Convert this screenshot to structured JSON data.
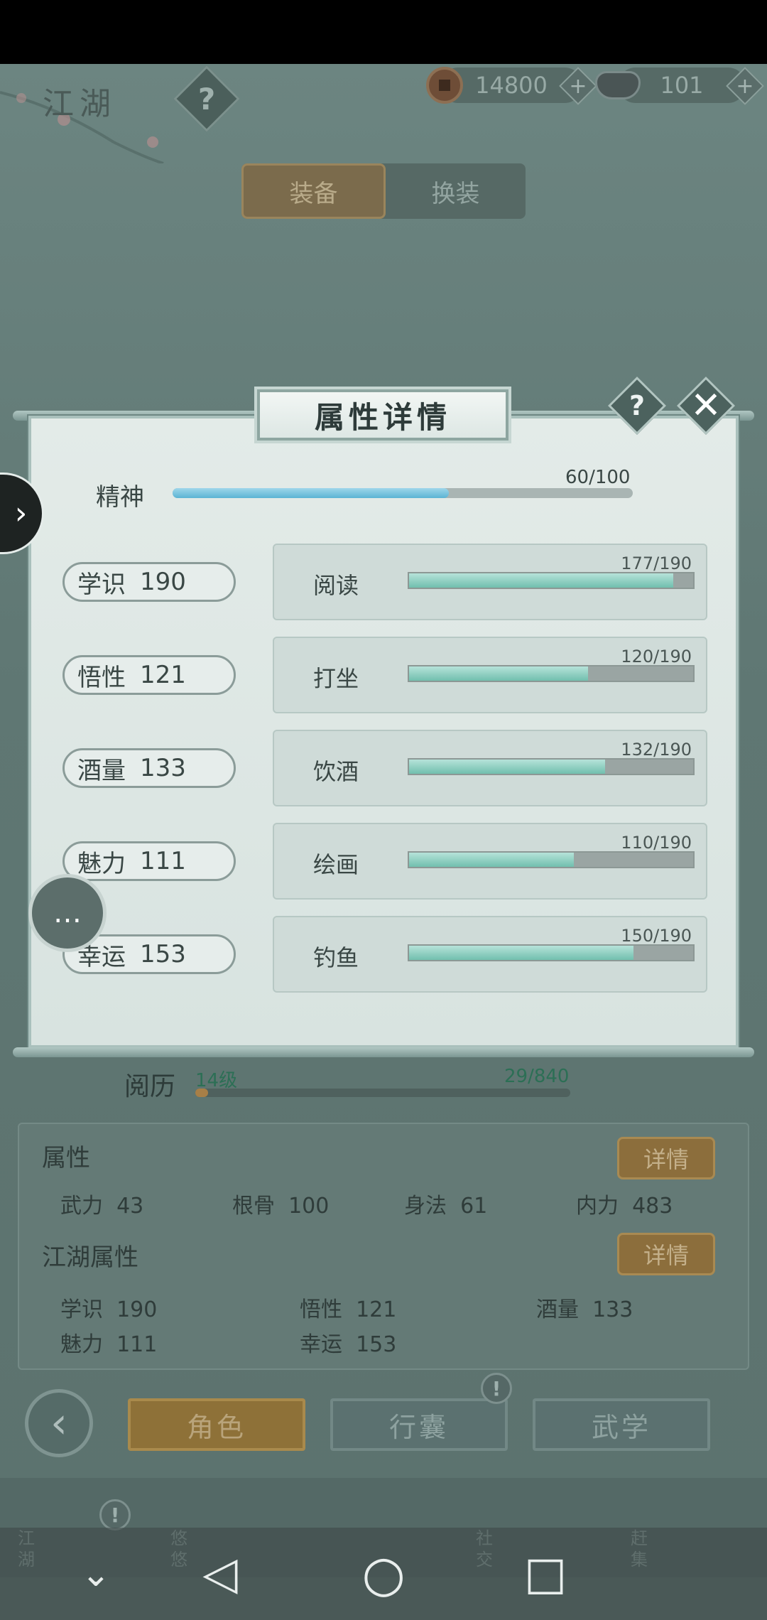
{
  "topbar": {
    "region_title": "江湖",
    "help_icon": "?",
    "copper": "14800",
    "silver": "101",
    "plus": "+"
  },
  "equip_tabs": [
    "装备",
    "换装"
  ],
  "dialog": {
    "title": "属性详情",
    "help": "?",
    "close": "✕",
    "spirit": {
      "label": "精神",
      "value": "60/100",
      "fraction": 0.6
    },
    "attributes": [
      {
        "label": "学识",
        "value": "190",
        "skill": "阅读",
        "progress": "177/190",
        "fraction": 0.93
      },
      {
        "label": "悟性",
        "value": "121",
        "skill": "打坐",
        "progress": "120/190",
        "fraction": 0.63
      },
      {
        "label": "酒量",
        "value": "133",
        "skill": "饮酒",
        "progress": "132/190",
        "fraction": 0.69
      },
      {
        "label": "魅力",
        "value": "111",
        "skill": "绘画",
        "progress": "110/190",
        "fraction": 0.58
      },
      {
        "label": "幸运",
        "value": "153",
        "skill": "钓鱼",
        "progress": "150/190",
        "fraction": 0.79
      }
    ]
  },
  "experience": {
    "label": "阅历",
    "level": "14级",
    "count": "29/840",
    "fraction": 0.035
  },
  "attributes_panel": {
    "heading": "属性",
    "detail_label": "详情",
    "stats": [
      {
        "name": "武力",
        "value": "43"
      },
      {
        "name": "根骨",
        "value": "100"
      },
      {
        "name": "身法",
        "value": "61"
      },
      {
        "name": "内力",
        "value": "483"
      }
    ],
    "jianghu_heading": "江湖属性",
    "jianghu_stats": [
      {
        "name": "学识",
        "value": "190"
      },
      {
        "name": "悟性",
        "value": "121"
      },
      {
        "name": "酒量",
        "value": "133"
      },
      {
        "name": "魅力",
        "value": "111"
      },
      {
        "name": "幸运",
        "value": "153"
      }
    ]
  },
  "bottom_nav": {
    "back_icon": "‹",
    "tabs": [
      "角色",
      "行囊",
      "武学"
    ],
    "alert": "!"
  },
  "footer_items": [
    "江湖",
    "悠悠",
    "社交",
    "赶集"
  ],
  "icons": {
    "back": "◁",
    "home": "○",
    "recents": "□",
    "down": "⌄",
    "side_arrow": "›",
    "chat": "…"
  },
  "colors": {
    "accent_gold": "#8e7138",
    "bar_teal": "#71bfae",
    "bar_blue": "#5bb4d4"
  }
}
